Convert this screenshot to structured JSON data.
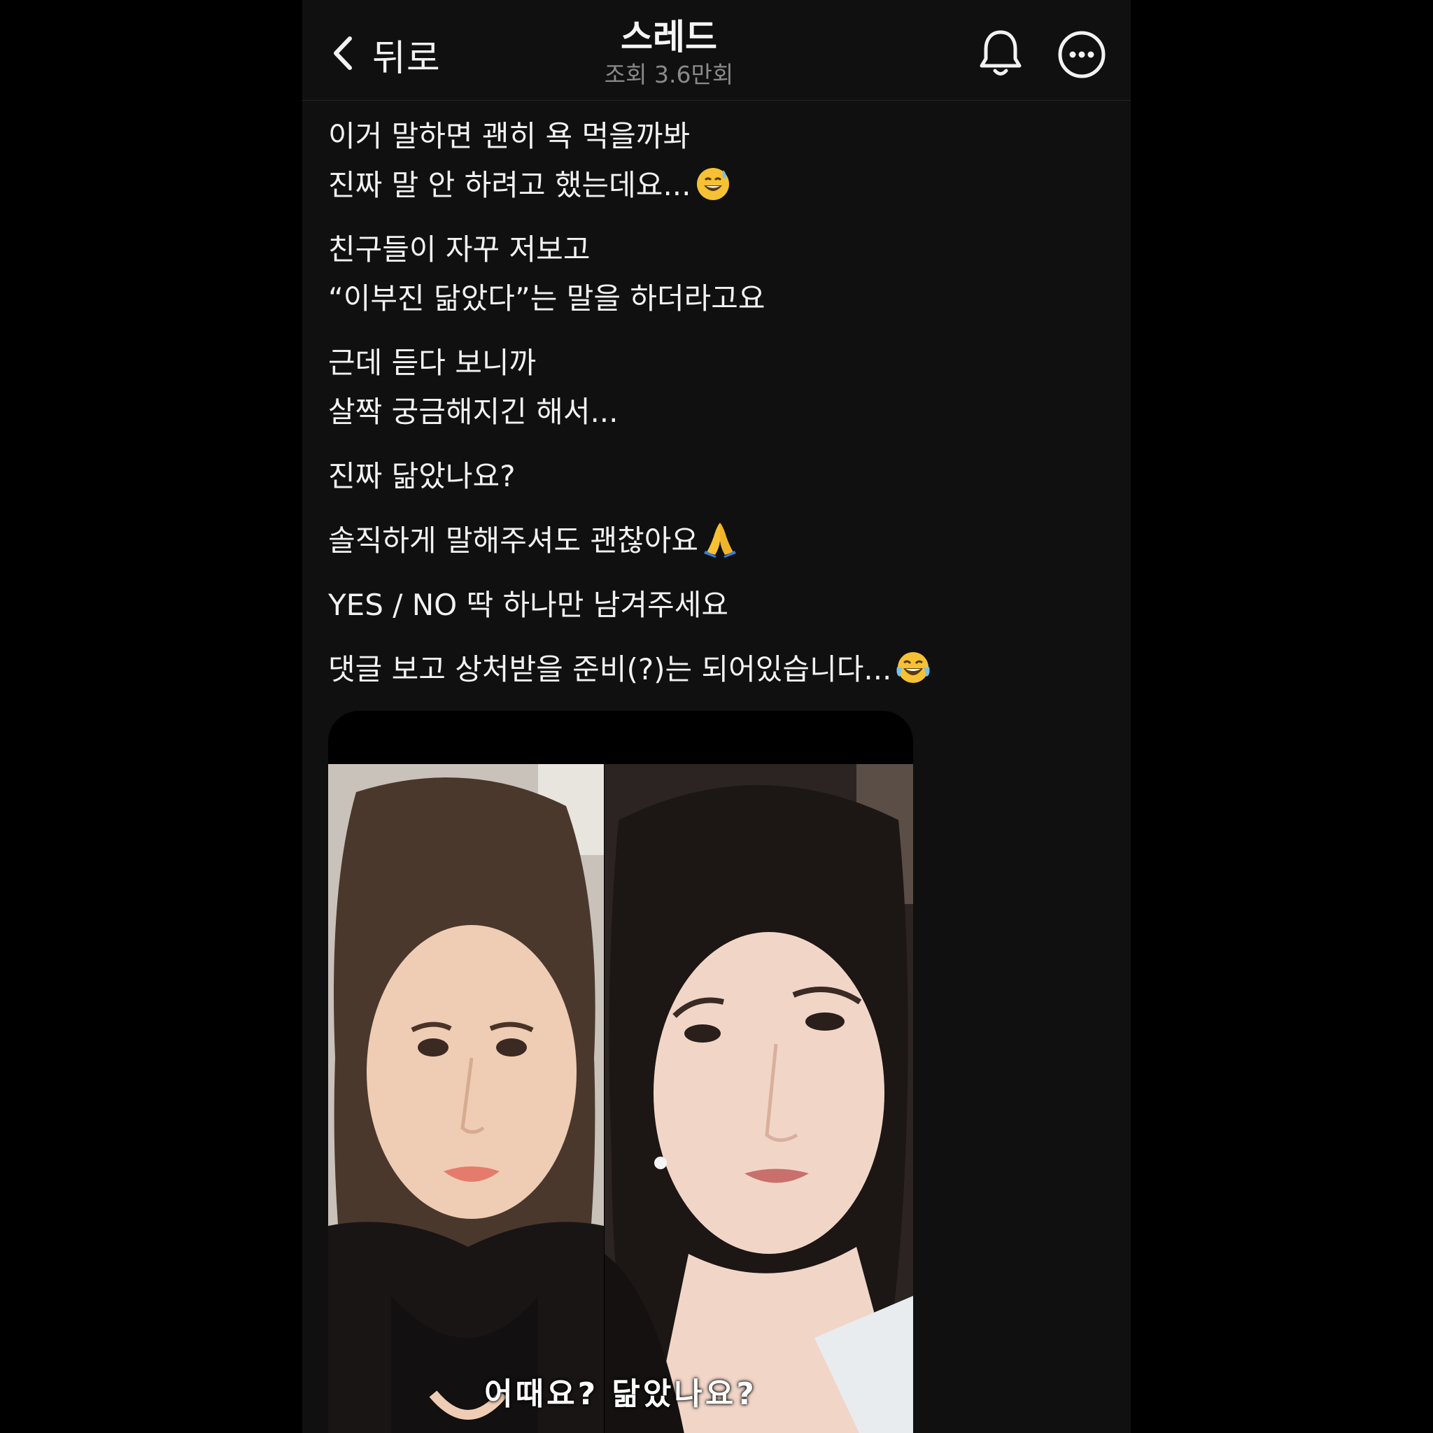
{
  "header": {
    "back_label": "뒤로",
    "title": "스레드",
    "views": "조회 3.6만회"
  },
  "post": {
    "paragraphs": [
      "이거 말하면 괜히 욕 먹을까봐\n진짜 말 안 하려고 했는데요...",
      "친구들이 자꾸 저보고\n“이부진 닮았다”는 말을 하더라고요",
      "근데 듣다 보니까\n살짝 궁금해지긴 해서...",
      "진짜 닮았나요?",
      "솔직하게 말해주셔도 괜찮아요",
      "YES / NO 딱 하나만 남겨주세요",
      "댓글 보고 상처받을 준비(?)는 되어있습니다..."
    ],
    "emojis": {
      "p0": "sweat-smile-emoji",
      "p4": "folded-hands-emoji",
      "p6": "tears-of-joy-emoji"
    }
  },
  "media": {
    "caption": "어때요? 닮았나요?"
  },
  "colors": {
    "background": "#101010",
    "text": "#f2f2f2",
    "muted": "#8a8a8a"
  }
}
